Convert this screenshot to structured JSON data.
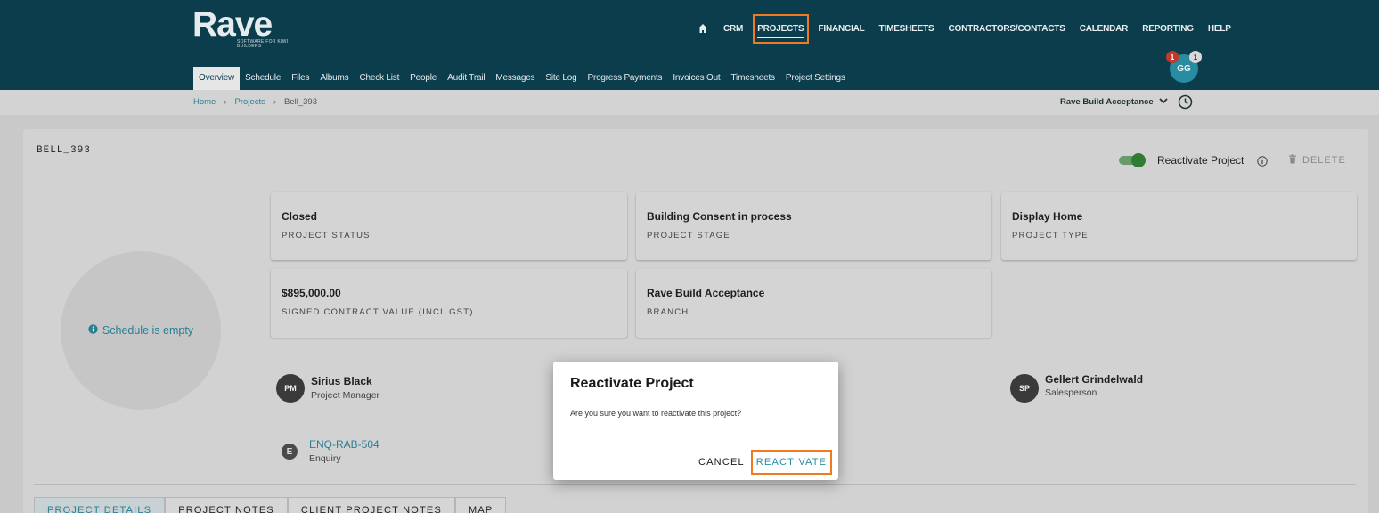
{
  "brand": {
    "name": "Rave",
    "tagline": "SOFTWARE FOR KIWI BUILDERS"
  },
  "main_nav": {
    "home_icon": "home-icon",
    "items": [
      "CRM",
      "PROJECTS",
      "FINANCIAL",
      "TIMESHEETS",
      "CONTRACTORS/CONTACTS",
      "CALENDAR",
      "REPORTING",
      "HELP"
    ],
    "active": "PROJECTS"
  },
  "sub_nav": {
    "items": [
      "Overview",
      "Schedule",
      "Files",
      "Albums",
      "Check List",
      "People",
      "Audit Trail",
      "Messages",
      "Site Log",
      "Progress Payments",
      "Invoices Out",
      "Timesheets",
      "Project Settings"
    ],
    "active": "Overview"
  },
  "user": {
    "initials": "GG",
    "badge_left": "1",
    "badge_right": "1"
  },
  "breadcrumb": {
    "home": "Home",
    "projects": "Projects",
    "current": "Bell_393"
  },
  "branch_selector": {
    "value": "Rave Build Acceptance"
  },
  "project": {
    "code": "BELL_393",
    "reactivate_label": "Reactivate Project",
    "delete_label": "DELETE",
    "schedule_empty": "Schedule is empty",
    "status": {
      "value": "Closed",
      "label": "PROJECT STATUS"
    },
    "stage": {
      "value": "Building Consent in process",
      "label": "PROJECT STAGE"
    },
    "type": {
      "value": "Display Home",
      "label": "PROJECT TYPE"
    },
    "contract": {
      "value": "$895,000.00",
      "label": "SIGNED CONTRACT VALUE (INCL GST)"
    },
    "branch": {
      "value": "Rave Build Acceptance",
      "label": "BRANCH"
    },
    "manager": {
      "initials": "PM",
      "name": "Sirius Black",
      "role": "Project Manager"
    },
    "salesperson": {
      "initials": "SP",
      "name": "Gellert Grindelwald",
      "role": "Salesperson"
    },
    "enquiry": {
      "initial": "E",
      "code": "ENQ-RAB-504",
      "label": "Enquiry"
    }
  },
  "detail_tabs": [
    "PROJECT DETAILS",
    "PROJECT NOTES",
    "CLIENT PROJECT NOTES",
    "MAP"
  ],
  "dialog": {
    "title": "Reactivate Project",
    "message": "Are you sure you want to reactivate this project?",
    "cancel": "CANCEL",
    "confirm": "REACTIVATE"
  },
  "colors": {
    "header": "#0b3d4d",
    "accent": "#2a8ca0",
    "highlight": "#f07a1e",
    "toggle_on": "#2e7d32"
  }
}
